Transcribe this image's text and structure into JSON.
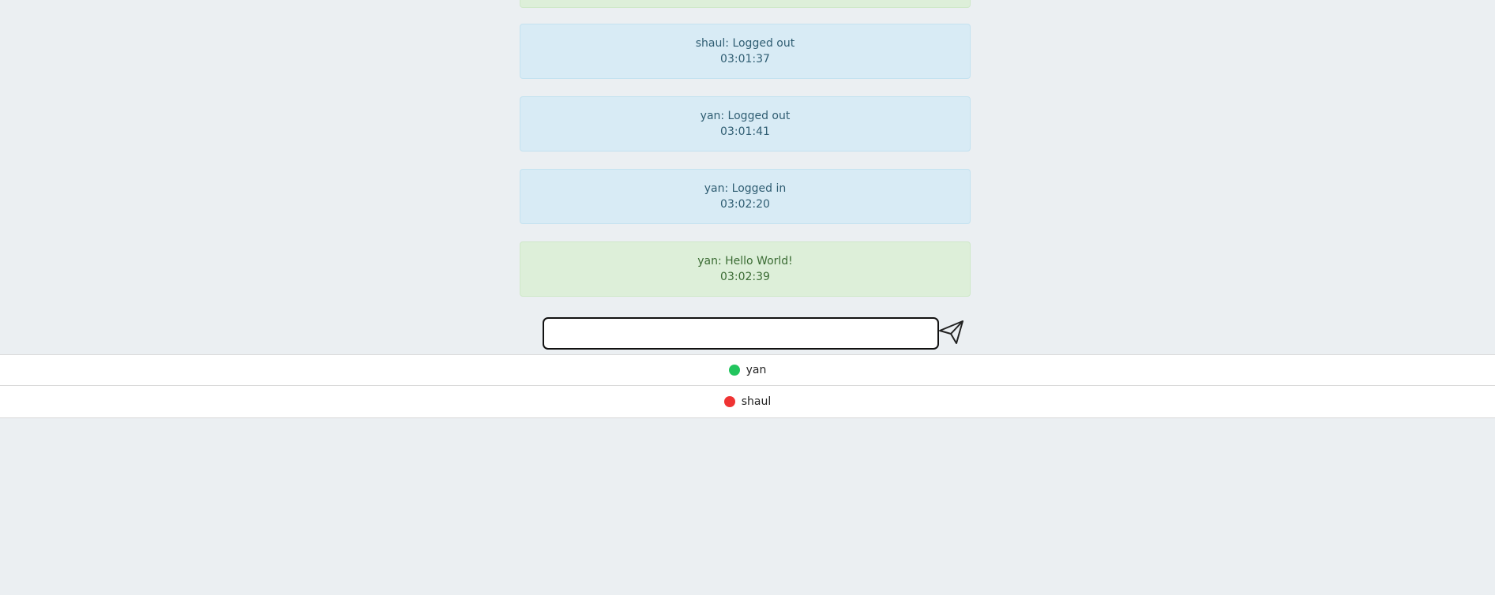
{
  "messages": [
    {
      "kind": "system",
      "text": "shaul: Logged out",
      "time": "03:01:37"
    },
    {
      "kind": "system",
      "text": "yan: Logged out",
      "time": "03:01:41"
    },
    {
      "kind": "system",
      "text": "yan: Logged in",
      "time": "03:02:20"
    },
    {
      "kind": "chat",
      "text": "yan: Hello World!",
      "time": "03:02:39"
    }
  ],
  "composer": {
    "value": "",
    "placeholder": "",
    "send_icon": "send-paper-plane-icon"
  },
  "users": [
    {
      "name": "yan",
      "status": "online",
      "status_color": "#22c55e"
    },
    {
      "name": "shaul",
      "status": "offline",
      "status_color": "#ef3333"
    }
  ],
  "colors": {
    "background": "#ebeff2",
    "system_message_bg": "#d8ebf5",
    "chat_message_bg": "#ddefd9"
  }
}
